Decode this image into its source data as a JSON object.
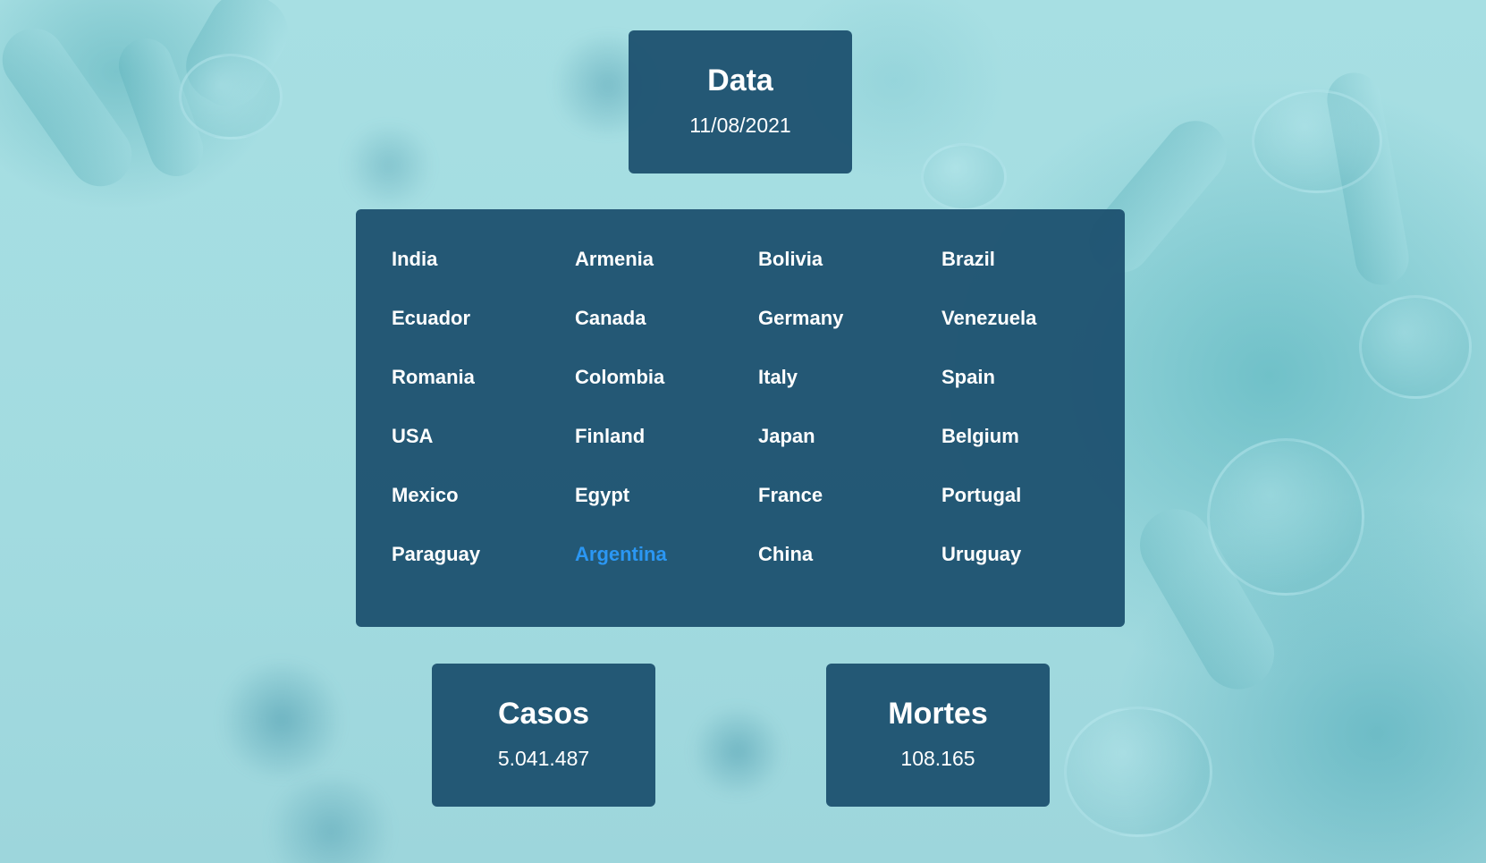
{
  "date_card": {
    "title": "Data",
    "value": "11/08/2021"
  },
  "countries": {
    "items": [
      "India",
      "Armenia",
      "Bolivia",
      "Brazil",
      "Ecuador",
      "Canada",
      "Germany",
      "Venezuela",
      "Romania",
      "Colombia",
      "Italy",
      "Spain",
      "USA",
      "Finland",
      "Japan",
      "Belgium",
      "Mexico",
      "Egypt",
      "France",
      "Portugal",
      "Paraguay",
      "Argentina",
      "China",
      "Uruguay"
    ],
    "selected": "Argentina",
    "selected_color": "#2b97f3"
  },
  "cases_card": {
    "title": "Casos",
    "value": "5.041.487"
  },
  "deaths_card": {
    "title": "Mortes",
    "value": "108.165"
  },
  "colors": {
    "card_background": "#1e5270",
    "page_background": "#a4dde2",
    "text": "#ffffff"
  }
}
